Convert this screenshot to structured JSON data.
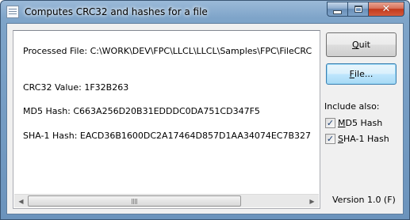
{
  "window": {
    "title": "Computes CRC32 and hashes for a file",
    "icon": "application-window-icon",
    "close_glyph": "✕"
  },
  "memo": {
    "processed_file": "Processed File: C:\\WORK\\DEV\\FPC\\LLCL\\LLCL\\Samples\\FPC\\FileCRC",
    "crc32": "CRC32 Value: 1F32B263",
    "md5": "MD5 Hash: C663A256D20B31EDDDC0DA751CD347F5",
    "sha1": "SHA-1 Hash: EACD36B1600DC2A17464D857D1AA34074EC7B327",
    "scroll_left": "◀",
    "scroll_right": "▶"
  },
  "buttons": {
    "quit_accel": "Q",
    "quit_rest": "uit",
    "file_accel": "F",
    "file_rest": "ile..."
  },
  "include": {
    "label": "Include also:",
    "md5": {
      "accel": "M",
      "rest": "D5 Hash",
      "checked": true,
      "mark": "✓"
    },
    "sha1": {
      "accel": "S",
      "rest": "HA-1 Hash",
      "checked": true,
      "mark": "✓"
    }
  },
  "version": "Version 1.0 (F)",
  "colors": {
    "accent": "#3c7fb1",
    "close": "#c2391c",
    "frame": "#7ea4c9"
  }
}
